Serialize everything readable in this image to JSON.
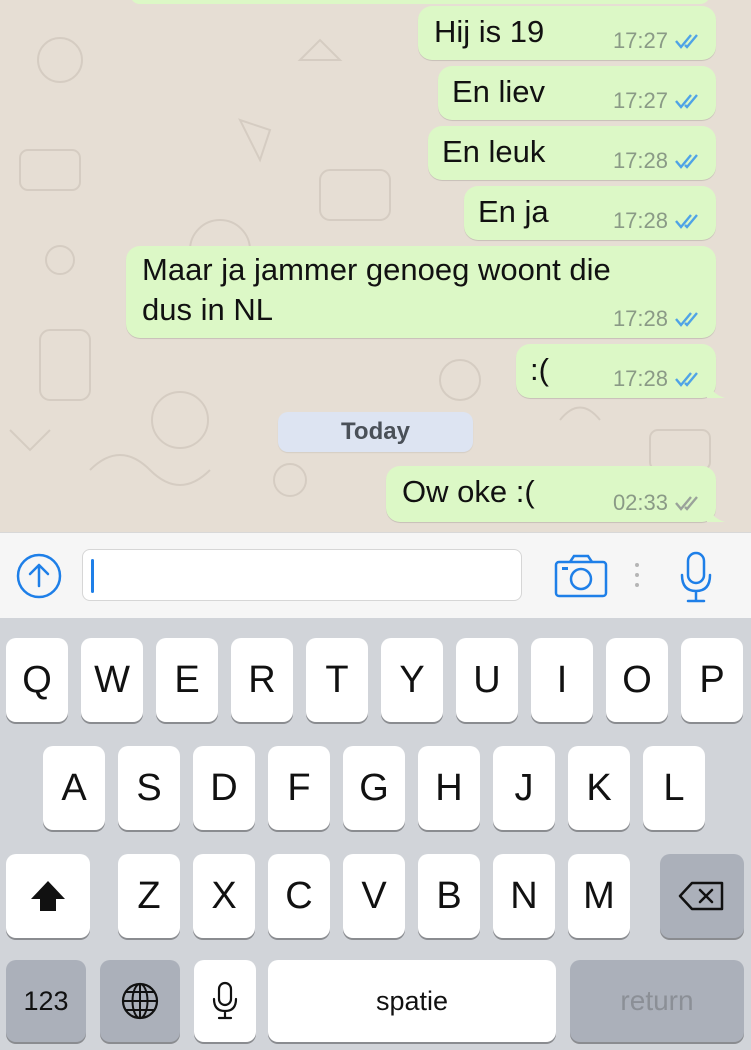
{
  "chat": {
    "messages": [
      {
        "text": "Hij is 19",
        "time": "17:27",
        "status": "read"
      },
      {
        "text": "En liev",
        "time": "17:27",
        "status": "read"
      },
      {
        "text": "En leuk",
        "time": "17:28",
        "status": "read"
      },
      {
        "text": "En ja",
        "time": "17:28",
        "status": "read"
      },
      {
        "text": "Maar ja jammer genoeg woont die\ndus in NL",
        "time": "17:28",
        "status": "read"
      },
      {
        "text": ":(",
        "time": "17:28",
        "status": "read"
      },
      {
        "text": "Ow oke :(",
        "time": "02:33",
        "status": "delivered"
      }
    ],
    "day_separator": "Today"
  },
  "input_bar": {
    "upload_icon": "arrow-up-circle-icon",
    "camera_icon": "camera-icon",
    "mic_icon": "microphone-icon",
    "text_value": ""
  },
  "keyboard": {
    "row1": [
      "Q",
      "W",
      "E",
      "R",
      "T",
      "Y",
      "U",
      "I",
      "O",
      "P"
    ],
    "row2": [
      "A",
      "S",
      "D",
      "F",
      "G",
      "H",
      "J",
      "K",
      "L"
    ],
    "row3": [
      "Z",
      "X",
      "C",
      "V",
      "B",
      "N",
      "M"
    ],
    "numbers_key": "123",
    "space_key": "spatie",
    "return_key": "return"
  },
  "colors": {
    "outgoing_bubble": "#dcf8c6",
    "read_tick": "#4fa3e6",
    "delivered_tick": "#9aa29a",
    "accent": "#1e7fe8"
  }
}
